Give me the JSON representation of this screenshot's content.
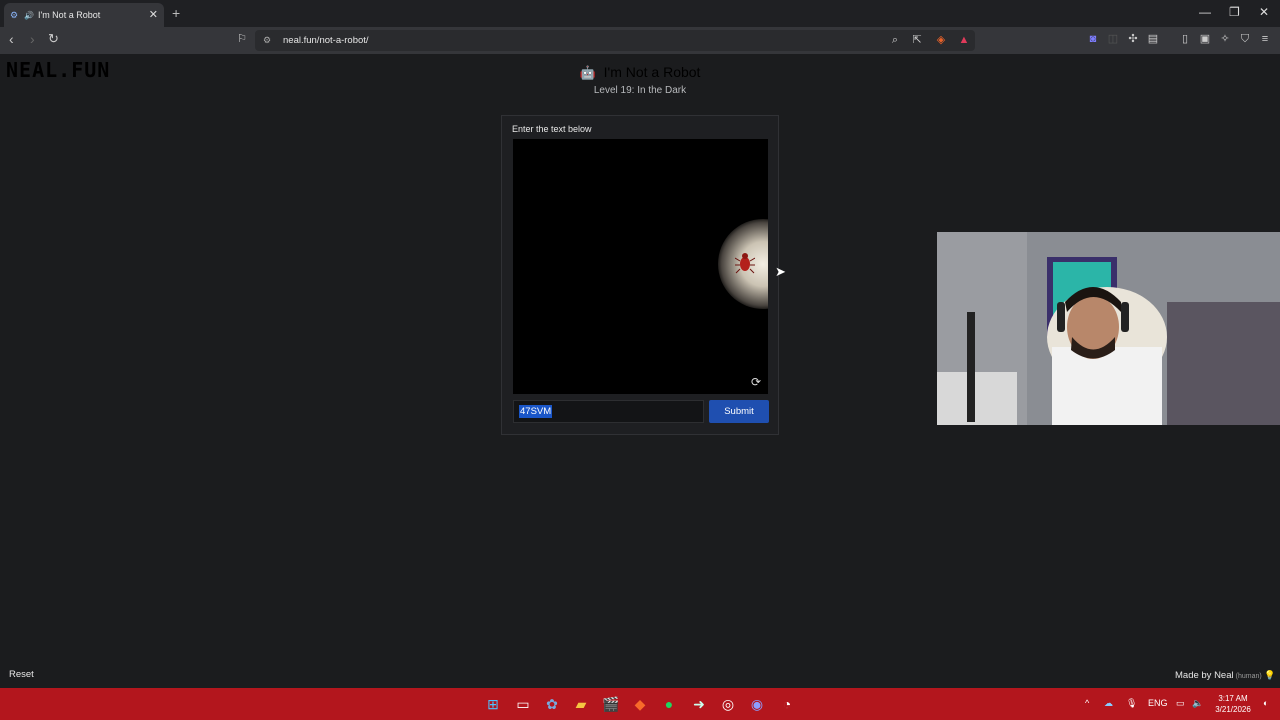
{
  "browser": {
    "tab_title": "I'm Not a Robot",
    "url": "neal.fun/not-a-robot/"
  },
  "page": {
    "logo": "NEAL.FUN",
    "title": "I'm Not a Robot",
    "level": "Level 19: In the Dark",
    "captcha": {
      "instruction": "Enter the text below",
      "answer_value": "47SVM",
      "submit_label": "Submit"
    },
    "reset_label": "Reset",
    "made_by": "Made by Neal",
    "made_by_tag": "(human)"
  },
  "taskbar": {
    "language": "ENG",
    "time": "3:17 AM",
    "date": "3/21/2026"
  },
  "colors": {
    "page_bg": "#1b1c1e",
    "accent_blue": "#1f4fb0",
    "taskbar_red": "#b3161d"
  }
}
